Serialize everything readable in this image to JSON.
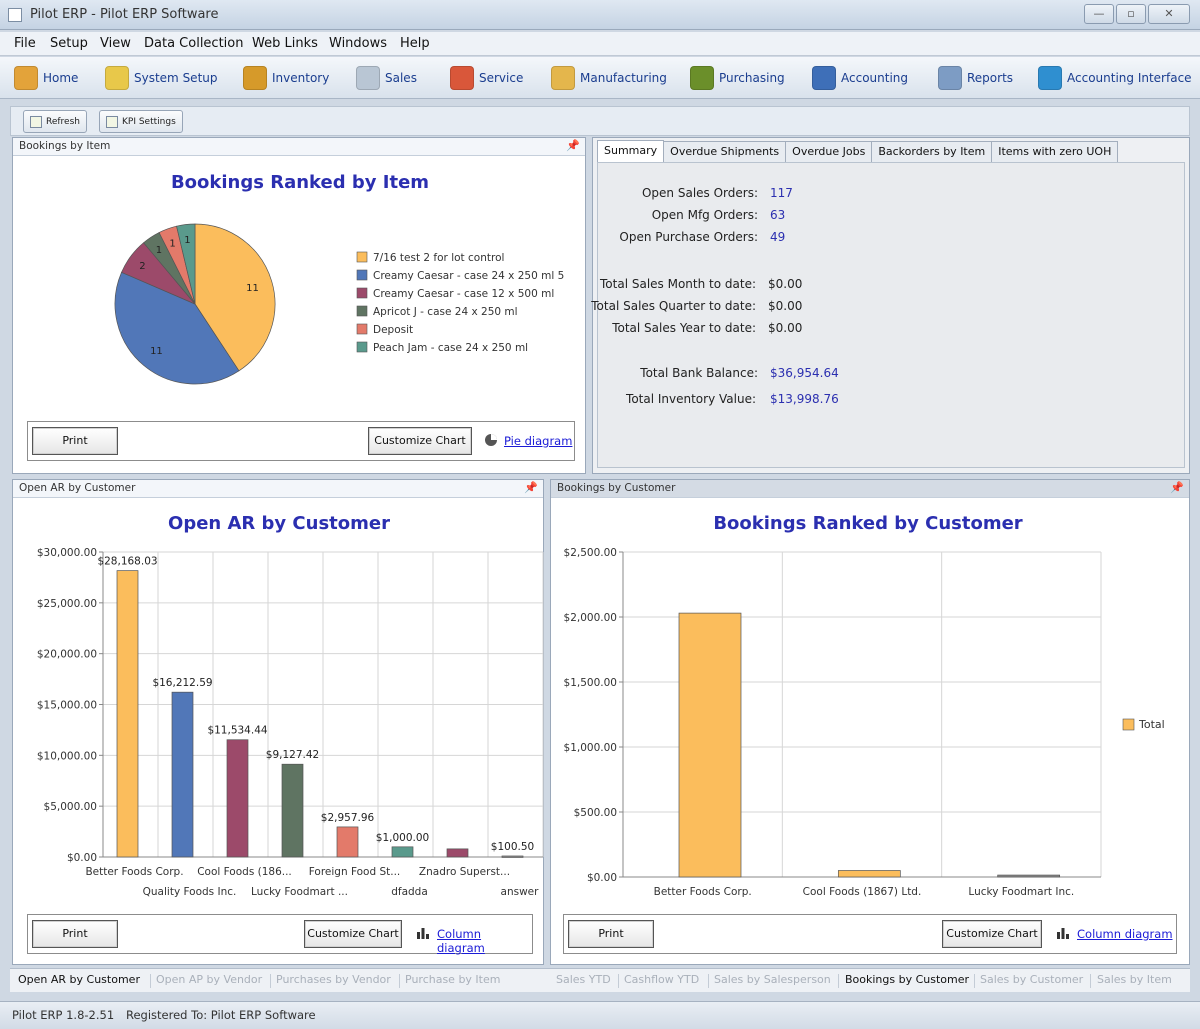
{
  "window": {
    "title": "Pilot ERP - Pilot ERP Software"
  },
  "menu": [
    "File",
    "Setup",
    "View",
    "Data Collection",
    "Web Links",
    "Windows",
    "Help"
  ],
  "toolbar": [
    {
      "label": "Home",
      "icon": "home-icon",
      "color": "#e3a33a"
    },
    {
      "label": "System Setup",
      "icon": "system-setup-icon",
      "color": "#e8c84a"
    },
    {
      "label": "Inventory",
      "icon": "inventory-icon",
      "color": "#d69a2a"
    },
    {
      "label": "Sales",
      "icon": "sales-icon",
      "color": "#b9c6d4"
    },
    {
      "label": "Service",
      "icon": "service-icon",
      "color": "#d9573a"
    },
    {
      "label": "Manufacturing",
      "icon": "manufacturing-icon",
      "color": "#e4b64c"
    },
    {
      "label": "Purchasing",
      "icon": "purchasing-icon",
      "color": "#6b8f2a"
    },
    {
      "label": "Accounting",
      "icon": "accounting-icon",
      "color": "#3e6fb8"
    },
    {
      "label": "Reports",
      "icon": "reports-icon",
      "color": "#7d9cc4"
    },
    {
      "label": "Accounting Interface",
      "icon": "accounting-interface-icon",
      "color": "#2f8fd0"
    }
  ],
  "subtoolbar": {
    "refresh": "Refresh",
    "kpi_settings": "KPI Settings"
  },
  "bookings_by_item": {
    "header": "Bookings by Item",
    "print": "Print",
    "customize": "Customize Chart",
    "link": "Pie diagram"
  },
  "open_ar": {
    "header": "Open AR by Customer",
    "print": "Print",
    "customize": "Customize Chart",
    "link": "Column diagram"
  },
  "bookings_by_customer": {
    "header": "Bookings by Customer",
    "print": "Print",
    "customize": "Customize Chart",
    "link": "Column diagram"
  },
  "summary": {
    "tabs": [
      "Summary",
      "Overdue Shipments",
      "Overdue Jobs",
      "Backorders by Item",
      "Items with zero UOH"
    ],
    "rows": [
      {
        "label": "Open Sales Orders:",
        "value": "117"
      },
      {
        "label": "Open Mfg Orders:",
        "value": "63"
      },
      {
        "label": "Open Purchase Orders:",
        "value": "49"
      },
      {
        "label": "Total Sales Month to date:",
        "value": "$0.00"
      },
      {
        "label": "Total Sales Quarter to date:",
        "value": "$0.00"
      },
      {
        "label": "Total Sales Year to date:",
        "value": "$0.00"
      },
      {
        "label": "Total Bank Balance:",
        "value": "$36,954.64"
      },
      {
        "label": "Total Inventory Value:",
        "value": "$13,998.76"
      }
    ]
  },
  "bottom_tabs": [
    "Open AR by Customer",
    "Open AP by Vendor",
    "Purchases by Vendor",
    "Purchase by Item",
    "Sales YTD",
    "Cashflow YTD",
    "Sales by Salesperson",
    "Bookings by Customer",
    "Sales by Customer",
    "Sales by Item"
  ],
  "status": {
    "version": "Pilot ERP 1.8-2.51",
    "registered": "Registered To: Pilot ERP Software"
  },
  "chart_data": [
    {
      "type": "pie",
      "title": "Bookings Ranked by Item",
      "legend_position": "right",
      "slices": [
        {
          "label": "7/16 test 2 for lot control",
          "value": 11,
          "color": "#fbbd5c"
        },
        {
          "label": "Creamy Caesar - case 24 x 250 ml 5",
          "value": 11,
          "color": "#5177b8"
        },
        {
          "label": "Creamy Caesar - case 12 x 500 ml",
          "value": 2,
          "color": "#9c4a6a"
        },
        {
          "label": "Apricot J - case 24 x 250 ml",
          "value": 1,
          "color": "#5f7462"
        },
        {
          "label": "Deposit",
          "value": 1,
          "color": "#e37a6a"
        },
        {
          "label": "Peach Jam - case 24 x 250 ml",
          "value": 1,
          "color": "#5a9a8c"
        }
      ]
    },
    {
      "type": "bar",
      "title": "Open AR by Customer",
      "categories": [
        "Better Foods Corp.",
        "Quality Foods Inc.",
        "Cool Foods (186...",
        "Lucky Foodmart ...",
        "Foreign Food St...",
        "dfadda",
        "Znadro Superst...",
        "answer"
      ],
      "values": [
        28168.03,
        16212.59,
        11534.44,
        9127.42,
        2957.96,
        1000.0,
        800,
        100.5
      ],
      "data_labels": [
        "$28,168.03",
        "$16,212.59",
        "$11,534.44",
        "$9,127.42",
        "$2,957.96",
        "$1,000.00",
        "",
        "$100.50"
      ],
      "colors": [
        "#fbbd5c",
        "#5177b8",
        "#9c4a6a",
        "#5f7462",
        "#e37a6a",
        "#5a9a8c",
        "#9c4a6a",
        "#8a8a8a"
      ],
      "ylim": [
        0,
        30000
      ],
      "yticks": [
        "$0.00",
        "$5,000.00",
        "$10,000.00",
        "$15,000.00",
        "$20,000.00",
        "$25,000.00",
        "$30,000.00"
      ],
      "grid": true
    },
    {
      "type": "bar",
      "title": "Bookings Ranked by Customer",
      "categories": [
        "Better Foods Corp.",
        "Cool Foods (1867) Ltd.",
        "Lucky Foodmart Inc."
      ],
      "values": [
        2030,
        50,
        15
      ],
      "series_name": "Total",
      "colors": [
        "#fbbd5c",
        "#fbbd5c",
        "#8a8a8a"
      ],
      "ylim": [
        0,
        2500
      ],
      "yticks": [
        "$0.00",
        "$500.00",
        "$1,000.00",
        "$1,500.00",
        "$2,000.00",
        "$2,500.00"
      ],
      "legend_position": "right",
      "grid": true
    }
  ]
}
